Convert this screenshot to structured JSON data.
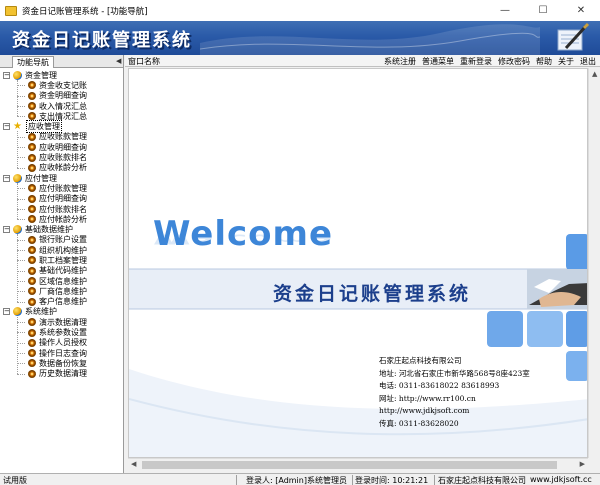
{
  "window": {
    "title": "资金日记账管理系统 - [功能导航]",
    "minimize": "—",
    "maximize": "☐",
    "close": "✕"
  },
  "banner": {
    "title": "资金日记账管理系统"
  },
  "nav": {
    "tab_label": "功能导航",
    "groups": [
      {
        "label": "资金管理",
        "icon": "globe-icon",
        "expander": "−",
        "items": [
          "资金收支记账",
          "资金明细查询",
          "收入情况汇总",
          "支出情况汇总"
        ]
      },
      {
        "label": "应收管理",
        "icon": "star-icon",
        "expander": "−",
        "items": [
          "应收账款管理",
          "应收明细查询",
          "应收账款排名",
          "应收帐龄分析"
        ]
      },
      {
        "label": "应付管理",
        "icon": "globe-icon",
        "expander": "−",
        "items": [
          "应付账款管理",
          "应付明细查询",
          "应付账款排名",
          "应付帐龄分析"
        ]
      },
      {
        "label": "基础数据维护",
        "icon": "globe-icon",
        "expander": "−",
        "items": [
          "银行账户设置",
          "组织机构维护",
          "职工档案管理",
          "基础代码维护",
          "区域信息维护",
          "厂商信息维护",
          "客户信息维护"
        ]
      },
      {
        "label": "系统维护",
        "icon": "globe-icon",
        "expander": "−",
        "items": [
          "演示数据清理",
          "系统参数设置",
          "操作人员授权",
          "操作日志查询",
          "数据备份恢复",
          "历史数据清理"
        ]
      }
    ]
  },
  "menubar": {
    "window_name_label": "窗口名称",
    "collapse_arrow": "◀",
    "items": [
      "系统注册",
      "普通菜单",
      "重新登录",
      "修改密码",
      "帮助",
      "关于",
      "退出"
    ]
  },
  "welcome": {
    "headline": "Welcome",
    "system_title": "资金日记账管理系统",
    "company": "石家庄起点科技有限公司",
    "address": "地址: 河北省石家庄市新华路568号8座423室",
    "phone": "电话: 0311-83618022  83618993",
    "website_label": "网址: http://www.rr100.cn",
    "website2": "http://www.jdkjsoft.com",
    "fax": "传真: 0311-83628020"
  },
  "statusbar": {
    "edition": "试用版",
    "login_user": "登录人: [Admin]系统管理员",
    "login_time": "登录时间: 10:21:21",
    "company": "石家庄起点科技有限公司",
    "site": "www.jdkjsoft.cc"
  },
  "colors": {
    "banner": "#2a5aa8",
    "welcome_blue": "#3d86d8",
    "title_navy": "#1c3f8c",
    "tile_blue": "#6fa8ea"
  }
}
